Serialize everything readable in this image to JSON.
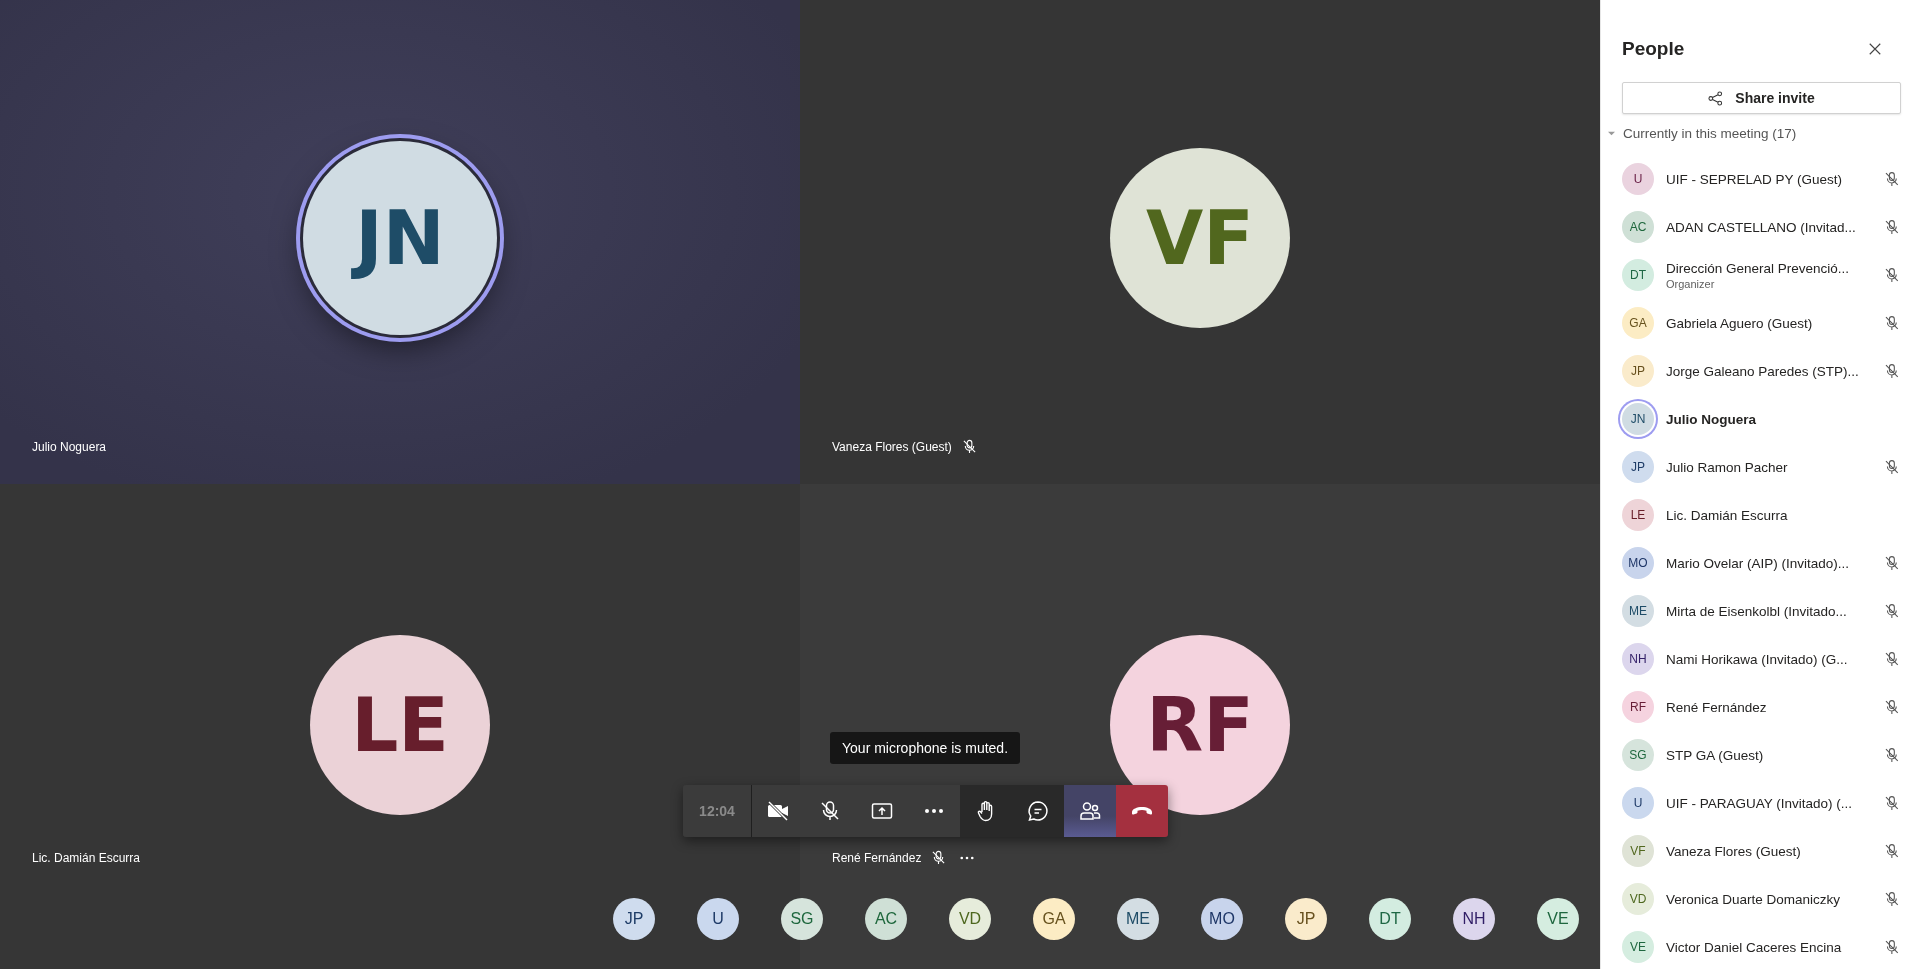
{
  "tiles": [
    {
      "name": "Julio Noguera",
      "initials": "JN",
      "color": "#d0dce3",
      "speaking": true,
      "muted": false,
      "more": false
    },
    {
      "name": "Vaneza Flores (Guest)",
      "initials": "VF",
      "color": "#dfe3d6",
      "speaking": false,
      "muted": true,
      "more": false
    },
    {
      "name": "Lic. Damián Escurra",
      "initials": "LE",
      "color": "#ebd2d7",
      "speaking": false,
      "muted": false,
      "more": false
    },
    {
      "name": "René Fernández",
      "initials": "RF",
      "color": "#f4d3de",
      "speaking": false,
      "muted": true,
      "more": true
    }
  ],
  "tooltip": "Your microphone is muted.",
  "call_bar": {
    "time": "12:04",
    "buttons": [
      {
        "kind": "camera",
        "selected": false
      },
      {
        "kind": "mic",
        "selected": false
      },
      {
        "kind": "share",
        "selected": false
      },
      {
        "kind": "more",
        "selected": false
      },
      {
        "kind": "hand",
        "selected": false
      },
      {
        "kind": "chat",
        "selected": false
      },
      {
        "kind": "people",
        "selected": true
      },
      {
        "kind": "hangup",
        "selected": false
      }
    ]
  },
  "overflow_avatars": [
    {
      "initials": "JP",
      "color": "#cfdcee"
    },
    {
      "initials": "U",
      "color": "#cad8ee"
    },
    {
      "initials": "SG",
      "color": "#d6e4dc"
    },
    {
      "initials": "AC",
      "color": "#cfe0d6"
    },
    {
      "initials": "VD",
      "color": "#e6ecdb"
    },
    {
      "initials": "GA",
      "color": "#fcecc4"
    },
    {
      "initials": "ME",
      "color": "#d3dde3"
    },
    {
      "initials": "MO",
      "color": "#c8d4ec"
    },
    {
      "initials": "JP",
      "color": "#faebcb"
    },
    {
      "initials": "DT",
      "color": "#d3ece0"
    },
    {
      "initials": "NH",
      "color": "#dcd6ed"
    },
    {
      "initials": "VE",
      "color": "#d5ede0"
    }
  ],
  "people_panel": {
    "title": "People",
    "share_button": "Share invite",
    "section": {
      "label": "Currently in this meeting (17)",
      "expanded": true,
      "participants": [
        {
          "initials": "U",
          "name": "UIF - SEPRELAD PY (Guest)",
          "color": "#ead3df",
          "muted": true,
          "speaking": false
        },
        {
          "initials": "AC",
          "name": "ADAN CASTELLANO (Invitad...",
          "color": "#cfe0d6",
          "muted": true,
          "speaking": false
        },
        {
          "initials": "DT",
          "name": "Dirección General Prevenció...",
          "role": "Organizer",
          "color": "#d3ece0",
          "muted": true,
          "speaking": false
        },
        {
          "initials": "GA",
          "name": "Gabriela Aguero (Guest)",
          "color": "#fcecc4",
          "muted": true,
          "speaking": false
        },
        {
          "initials": "JP",
          "name": "Jorge Galeano Paredes (STP)...",
          "color": "#faebcb",
          "muted": true,
          "speaking": false
        },
        {
          "initials": "JN",
          "name": "Julio Noguera",
          "color": "#d0dce3",
          "muted": false,
          "speaking": true
        },
        {
          "initials": "JP",
          "name": "Julio Ramon Pacher",
          "color": "#cfdcee",
          "muted": true,
          "speaking": false
        },
        {
          "initials": "LE",
          "name": "Lic. Damián Escurra",
          "color": "#eed4d8",
          "muted": false,
          "speaking": false
        },
        {
          "initials": "MO",
          "name": "Mario Ovelar (AIP) (Invitado)...",
          "color": "#c8d4ec",
          "muted": true,
          "speaking": false
        },
        {
          "initials": "ME",
          "name": "Mirta de Eisenkolbl (Invitado...",
          "color": "#d3dde3",
          "muted": true,
          "speaking": false
        },
        {
          "initials": "NH",
          "name": "Nami Horikawa (Invitado) (G...",
          "color": "#dcd6ed",
          "muted": true,
          "speaking": false
        },
        {
          "initials": "RF",
          "name": "René Fernández",
          "color": "#f5d3df",
          "muted": true,
          "speaking": false
        },
        {
          "initials": "SG",
          "name": "STP GA (Guest)",
          "color": "#d6e4dc",
          "muted": true,
          "speaking": false
        },
        {
          "initials": "U",
          "name": "UIF - PARAGUAY (Invitado) (...",
          "color": "#cad8ee",
          "muted": true,
          "speaking": false
        },
        {
          "initials": "VF",
          "name": "Vaneza Flores (Guest)",
          "color": "#dfe3d6",
          "muted": true,
          "speaking": false
        },
        {
          "initials": "VD",
          "name": "Veronica Duarte Domaniczky",
          "color": "#e6ecdb",
          "muted": true,
          "speaking": false
        },
        {
          "initials": "VE",
          "name": "Victor Daniel Caceres Encina",
          "color": "#d5ede0",
          "muted": true,
          "speaking": false
        }
      ]
    }
  }
}
